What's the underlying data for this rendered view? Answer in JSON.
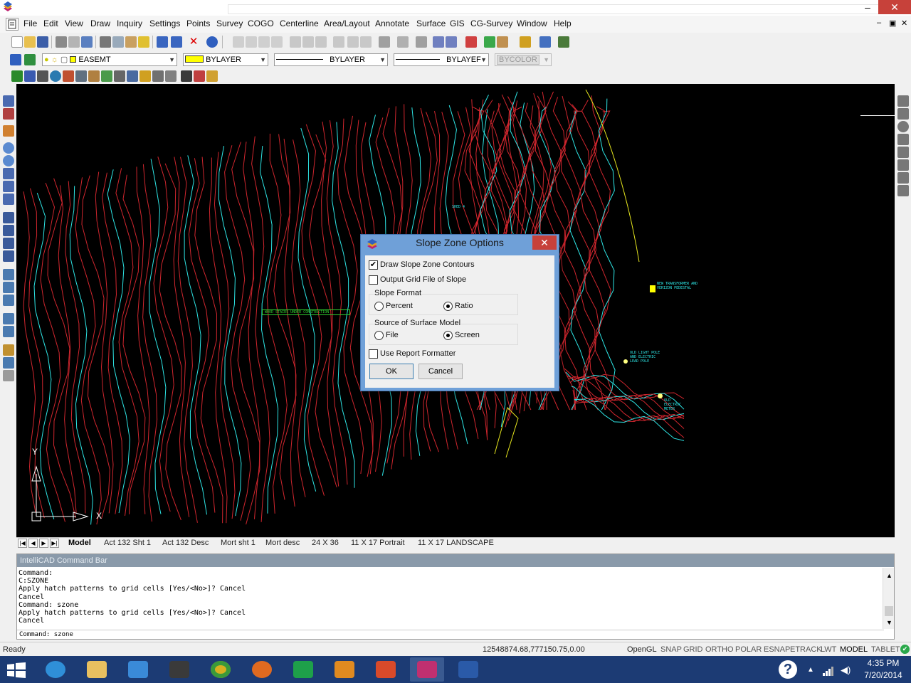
{
  "window": {
    "minimize_glyph": "–",
    "close_glyph": "✕"
  },
  "menu": [
    "File",
    "Edit",
    "View",
    "Draw",
    "Inquiry",
    "Settings",
    "Points",
    "Survey",
    "COGO",
    "Centerline",
    "Area/Layout",
    "Annotate",
    "Surface",
    "GIS",
    "CG-Survey",
    "Window",
    "Help"
  ],
  "doc_controls": {
    "minimize": "–",
    "restore": "▣",
    "close": "✕"
  },
  "layer_toolbar": {
    "layer": "EASEMT",
    "color": "BYLAYER",
    "linetype": "BYLAYER",
    "lineweight": "BYLAYEF",
    "plot_style": "BYCOLOR"
  },
  "colors": {
    "contour_major": "#d0262e",
    "contour_index": "#2ee6e6",
    "boundary": "#e6e61e",
    "dialog_frame": "#6fa0d8",
    "taskbar": "#1c3b74",
    "close_red": "#c7413a"
  },
  "drawing": {
    "annotations": [
      {
        "text": "WOOD STAIRS UNDER CONSTRUCTION"
      },
      {
        "text": "NEW TRANSFORMER AND VERIZON PEDESTAL"
      },
      {
        "text": "OLD LIGHT POLE AND ELECTRIC LEAD POLE"
      },
      {
        "text": "OLD ELECTRIC METER"
      },
      {
        "text": "SHED 4"
      }
    ],
    "ucs": {
      "x_label": "X",
      "y_label": "Y"
    }
  },
  "tabs": [
    "Model",
    "Act 132 Sht 1",
    "Act 132 Desc",
    "Mort sht 1",
    "Mort desc",
    "24 X 36",
    "11 X 17 Portrait",
    "11 X 17 LANDSCAPE"
  ],
  "command_bar": {
    "title": "IntelliCAD Command Bar",
    "history": "Command:\nC:SZONE\nApply hatch patterns to grid cells [Yes/<No>]? Cancel\nCancel\nCommand: szone\nApply hatch patterns to grid cells [Yes/<No>]? Cancel\nCancel",
    "current": "Command: szone"
  },
  "status": {
    "ready": "Ready",
    "coords": "12548874.68,777150.75,0.00",
    "toggles": [
      "OpenGL",
      "SNAP",
      "GRID",
      "ORTHO",
      "POLAR",
      "ESNAP",
      "ETRACK",
      "LWT",
      "MODEL",
      "TABLET"
    ]
  },
  "taskbar": {
    "apps": [
      "windows-start",
      "internet-explorer",
      "file-explorer",
      "rocket-app",
      "puzzle-app",
      "chrome",
      "firefox",
      "store",
      "media-player",
      "acrobat",
      "carlson-cad",
      "word"
    ],
    "clock_time": "4:35 PM",
    "clock_date": "7/20/2014",
    "help_glyph": "?"
  },
  "dialog": {
    "title": "Slope Zone Options",
    "draw_contours": {
      "label": "Draw Slope Zone Contours",
      "checked": true
    },
    "output_grid": {
      "label": "Output Grid File of Slope",
      "checked": false
    },
    "slope_format": {
      "label": "Slope Format",
      "options": [
        "Percent",
        "Ratio"
      ],
      "selected": "Ratio"
    },
    "surface_source": {
      "label": "Source of Surface Model",
      "options": [
        "File",
        "Screen"
      ],
      "selected": "Screen"
    },
    "report_formatter": {
      "label": "Use Report Formatter",
      "checked": false
    },
    "ok": "OK",
    "cancel": "Cancel",
    "close_glyph": "✕",
    "check_glyph": "✔"
  }
}
